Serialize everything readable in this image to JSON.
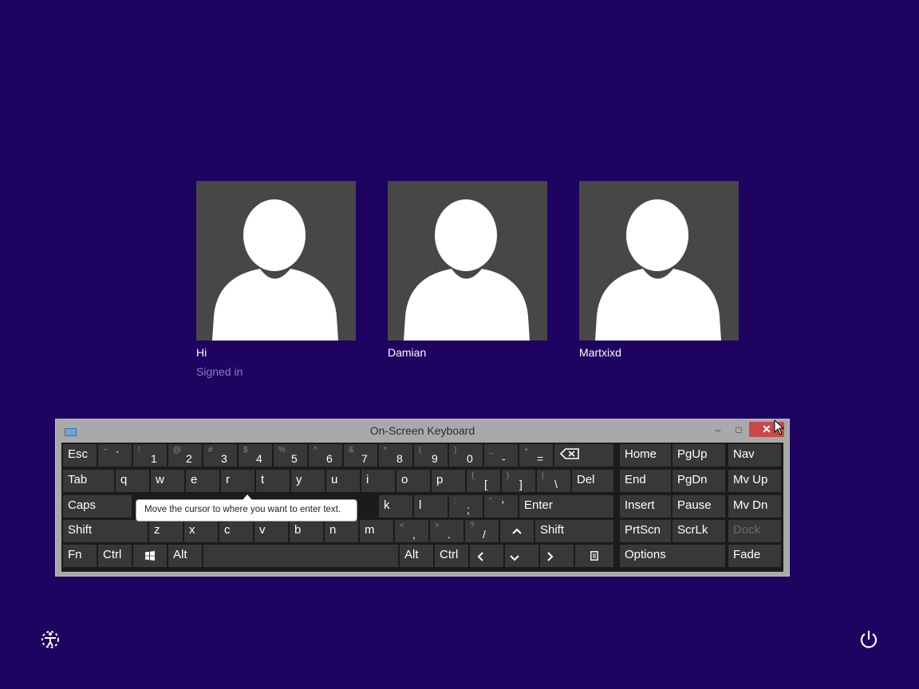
{
  "users": [
    {
      "name": "Hi",
      "status": "Signed in"
    },
    {
      "name": "Damian",
      "status": ""
    },
    {
      "name": "Martxixd",
      "status": ""
    }
  ],
  "osk": {
    "title": "On-Screen Keyboard",
    "minimize": "–",
    "maximize": "□",
    "close": "✕",
    "tooltip": "Move the cursor to where you want to enter text.",
    "keys": {
      "esc": "Esc",
      "backtick": {
        "shift": "~",
        "main": "`"
      },
      "d1": {
        "shift": "!",
        "main": "1"
      },
      "d2": {
        "shift": "@",
        "main": "2"
      },
      "d3": {
        "shift": "#",
        "main": "3"
      },
      "d4": {
        "shift": "$",
        "main": "4"
      },
      "d5": {
        "shift": "%",
        "main": "5"
      },
      "d6": {
        "shift": "^",
        "main": "6"
      },
      "d7": {
        "shift": "&",
        "main": "7"
      },
      "d8": {
        "shift": "*",
        "main": "8"
      },
      "d9": {
        "shift": "(",
        "main": "9"
      },
      "d0": {
        "shift": ")",
        "main": "0"
      },
      "minus": {
        "shift": "_",
        "main": "-"
      },
      "equals": {
        "shift": "+",
        "main": "="
      },
      "tab": "Tab",
      "q": "q",
      "w": "w",
      "e": "e",
      "r": "r",
      "t": "t",
      "y": "y",
      "u": "u",
      "i": "i",
      "o": "o",
      "p": "p",
      "lbracket": {
        "shift": "{",
        "main": "["
      },
      "rbracket": {
        "shift": "}",
        "main": "]"
      },
      "backslash": {
        "shift": "|",
        "main": "\\"
      },
      "del": "Del",
      "caps": "Caps",
      "k": "k",
      "l": "l",
      "semicolon": {
        "shift": ":",
        "main": ";"
      },
      "quote": {
        "shift": "\"",
        "main": "'"
      },
      "enter": "Enter",
      "shift": "Shift",
      "z": "z",
      "x": "x",
      "c": "c",
      "v": "v",
      "b": "b",
      "n": "n",
      "m": "m",
      "comma": {
        "shift": "<",
        "main": ","
      },
      "period": {
        "shift": ">",
        "main": "."
      },
      "slash": {
        "shift": "?",
        "main": "/"
      },
      "fn": "Fn",
      "ctrl": "Ctrl",
      "alt": "Alt",
      "home": "Home",
      "pgup": "PgUp",
      "nav": "Nav",
      "end": "End",
      "pgdn": "PgDn",
      "mvup": "Mv Up",
      "insert": "Insert",
      "pause": "Pause",
      "mvdn": "Mv Dn",
      "prtscn": "PrtScn",
      "scrlk": "ScrLk",
      "dock": "Dock",
      "options": "Options",
      "fade": "Fade"
    }
  },
  "icons": {
    "backspace": "backspace-icon",
    "windows": "windows-logo-icon",
    "arrows": [
      "arrow-up-icon",
      "arrow-left-icon",
      "arrow-down-icon",
      "arrow-right-icon"
    ],
    "menu": "context-menu-icon",
    "ease_of_access": "ease-of-access-icon",
    "power": "power-icon"
  },
  "colors": {
    "background": "#1e0360",
    "tile": "#474747",
    "key": "#383838",
    "close": "#c9484a",
    "signed_in": "#8f7fc4"
  }
}
